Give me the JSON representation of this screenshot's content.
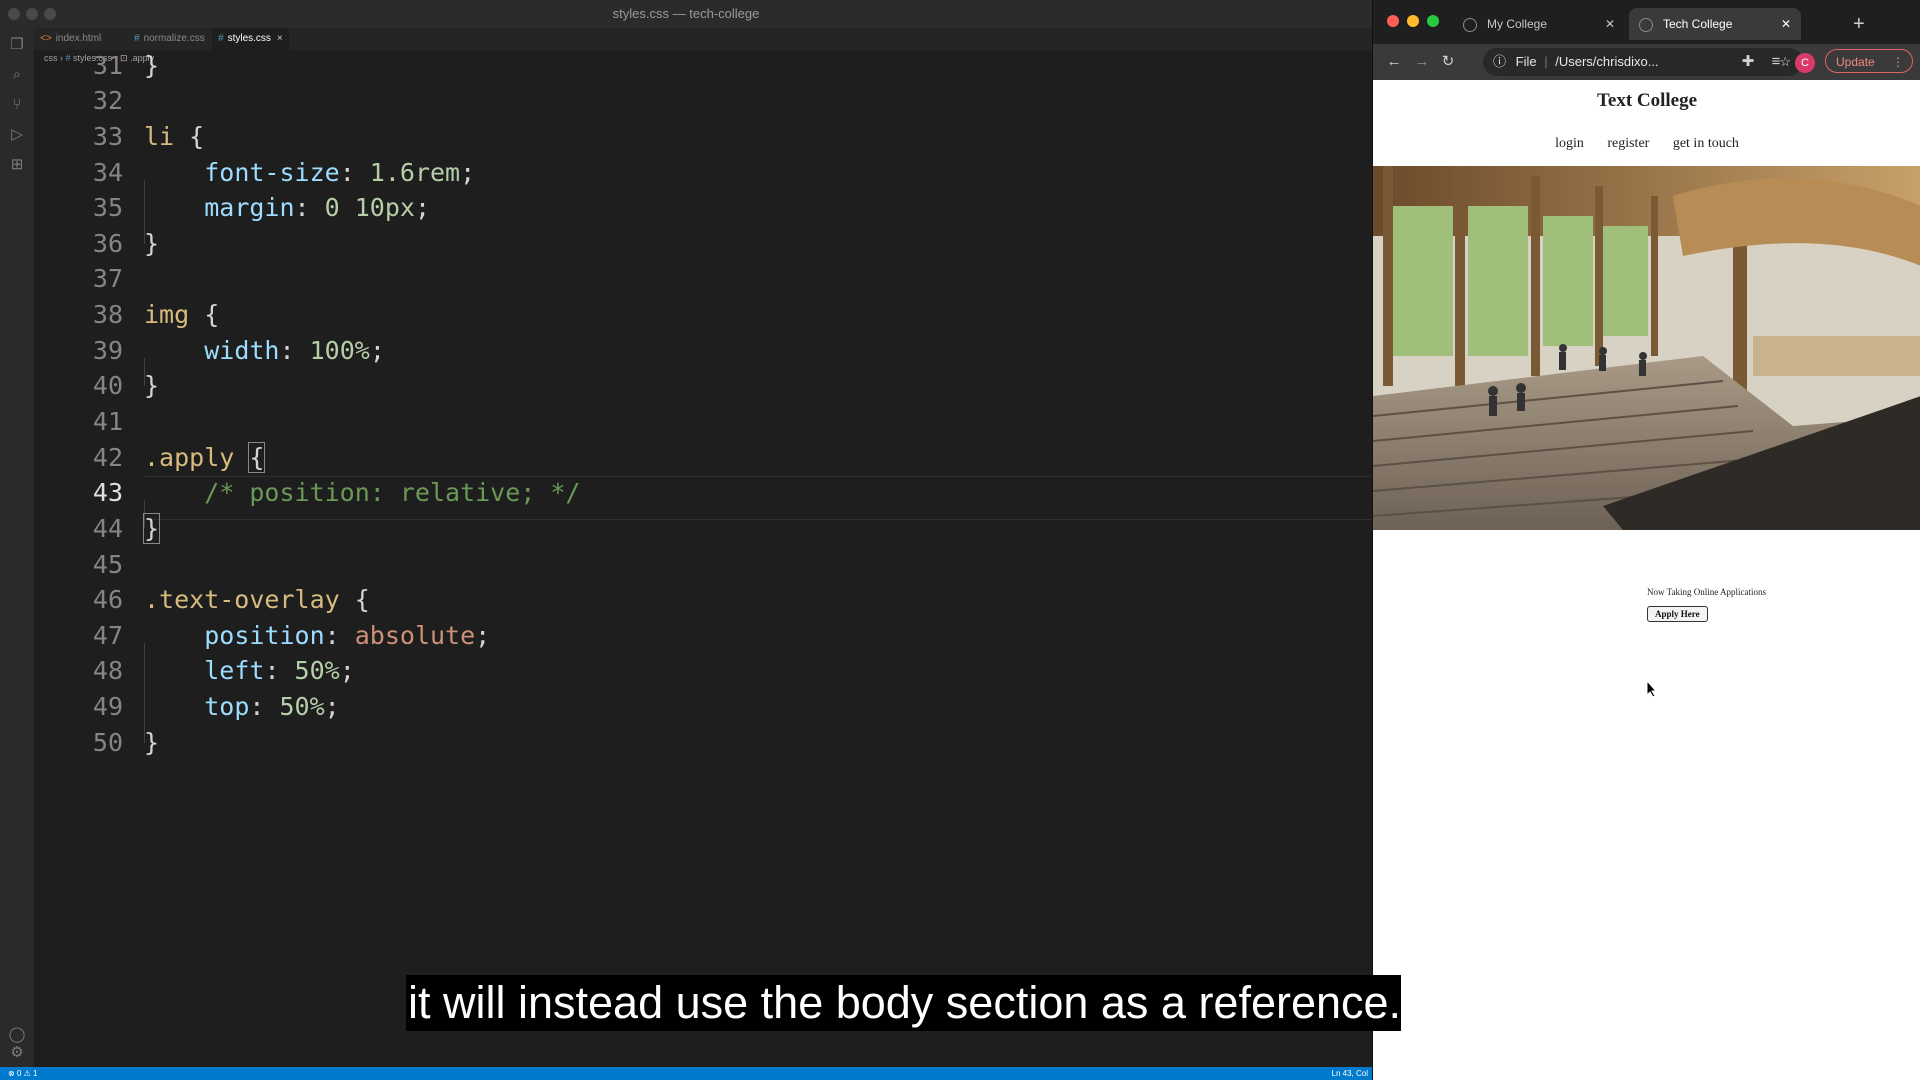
{
  "vscode": {
    "window_title": "styles.css — tech-college",
    "tabs": [
      {
        "label": "index.html",
        "active": false
      },
      {
        "label": "normalize.css",
        "active": false
      },
      {
        "label": "styles.css",
        "active": true
      }
    ],
    "breadcrumb": {
      "folder": "css",
      "file": "styles.css",
      "symbol": ".apply"
    },
    "lines": [
      {
        "no": "31",
        "text": "}"
      },
      {
        "no": "32",
        "text": ""
      },
      {
        "no": "33",
        "text": "li {"
      },
      {
        "no": "34",
        "text": "    font-size: 1.6rem;"
      },
      {
        "no": "35",
        "text": "    margin: 0 10px;"
      },
      {
        "no": "36",
        "text": "}"
      },
      {
        "no": "37",
        "text": ""
      },
      {
        "no": "38",
        "text": "img {"
      },
      {
        "no": "39",
        "text": "    width: 100%;"
      },
      {
        "no": "40",
        "text": "}"
      },
      {
        "no": "41",
        "text": ""
      },
      {
        "no": "42",
        "text": ".apply {"
      },
      {
        "no": "43",
        "text": "    /* position: relative; */"
      },
      {
        "no": "44",
        "text": "}"
      },
      {
        "no": "45",
        "text": ""
      },
      {
        "no": "46",
        "text": ".text-overlay {"
      },
      {
        "no": "47",
        "text": "    position: absolute;"
      },
      {
        "no": "48",
        "text": "    left: 50%;"
      },
      {
        "no": "49",
        "text": "    top: 50%;"
      },
      {
        "no": "50",
        "text": "}"
      }
    ],
    "current_line": "43",
    "status": {
      "left": "⊗ 0 ⚠ 1",
      "right": "Ln 43, Col"
    }
  },
  "browser": {
    "tabs": [
      {
        "label": "My College",
        "active": false
      },
      {
        "label": "Tech College",
        "active": true
      }
    ],
    "address": {
      "scheme": "File",
      "path": "/Users/chrisdixo..."
    },
    "update_label": "Update",
    "avatar_letter": "C",
    "page": {
      "title": "Text College",
      "nav": [
        "login",
        "register",
        "get in touch"
      ],
      "apply_text": "Now Taking Online Applications",
      "apply_button": "Apply Here"
    }
  },
  "caption": "it will instead use the body section as a reference.",
  "colors": {
    "editor_bg": "#1e1e1e",
    "selector": "#d7ba7d",
    "property": "#9cdcfe",
    "number": "#b5cea8",
    "keyword": "#ce9178",
    "comment": "#6a9955",
    "statusbar": "#007acc"
  }
}
